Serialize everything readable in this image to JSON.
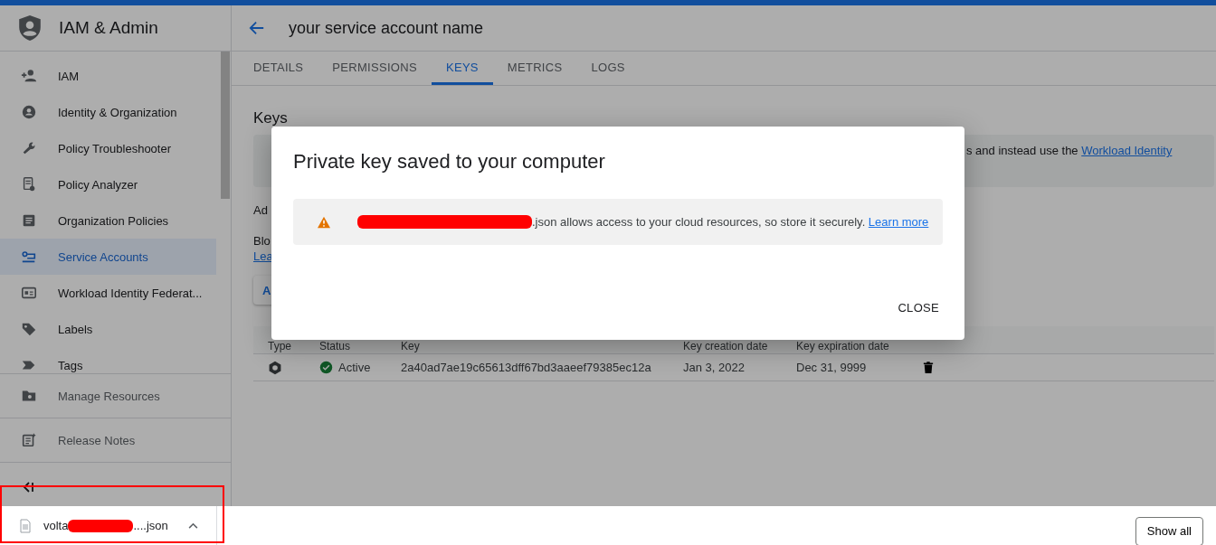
{
  "sidebar": {
    "title": "IAM & Admin",
    "items": [
      {
        "label": "IAM",
        "selected": false
      },
      {
        "label": "Identity & Organization",
        "selected": false
      },
      {
        "label": "Policy Troubleshooter",
        "selected": false
      },
      {
        "label": "Policy Analyzer",
        "selected": false
      },
      {
        "label": "Organization Policies",
        "selected": false
      },
      {
        "label": "Service Accounts",
        "selected": true
      },
      {
        "label": "Workload Identity Federat...",
        "selected": false
      },
      {
        "label": "Labels",
        "selected": false
      },
      {
        "label": "Tags",
        "selected": false
      }
    ],
    "footer_items": [
      {
        "label": "Manage Resources"
      },
      {
        "label": "Release Notes"
      }
    ]
  },
  "header": {
    "title": "your service account name"
  },
  "tabs": [
    {
      "label": "DETAILS",
      "selected": false
    },
    {
      "label": "PERMISSIONS",
      "selected": false
    },
    {
      "label": "KEYS",
      "selected": true
    },
    {
      "label": "METRICS",
      "selected": false
    },
    {
      "label": "LOGS",
      "selected": false
    }
  ],
  "keys_section": {
    "title": "Keys",
    "banner_text": "s and instead use the",
    "banner_link": "Workload Identity",
    "line_1": "Ad",
    "line_2": "Blo",
    "link": "Lea",
    "button": "A"
  },
  "table": {
    "columns": [
      "Type",
      "Status",
      "Key",
      "Key creation date",
      "Key expiration date"
    ],
    "rows": [
      {
        "status": "Active",
        "key": "2a40ad7ae19c65613dff67bd3aaeef79385ec12a",
        "created": "Jan 3, 2022",
        "expires": "Dec 31, 9999"
      }
    ]
  },
  "dialog": {
    "title": "Private key saved to your computer",
    "message": ".json allows access to your cloud resources, so store it securely.",
    "link": "Learn more",
    "button": "CLOSE"
  },
  "download_bar": {
    "file_start": "volta",
    "file_end": "....json",
    "button": "Show all"
  }
}
